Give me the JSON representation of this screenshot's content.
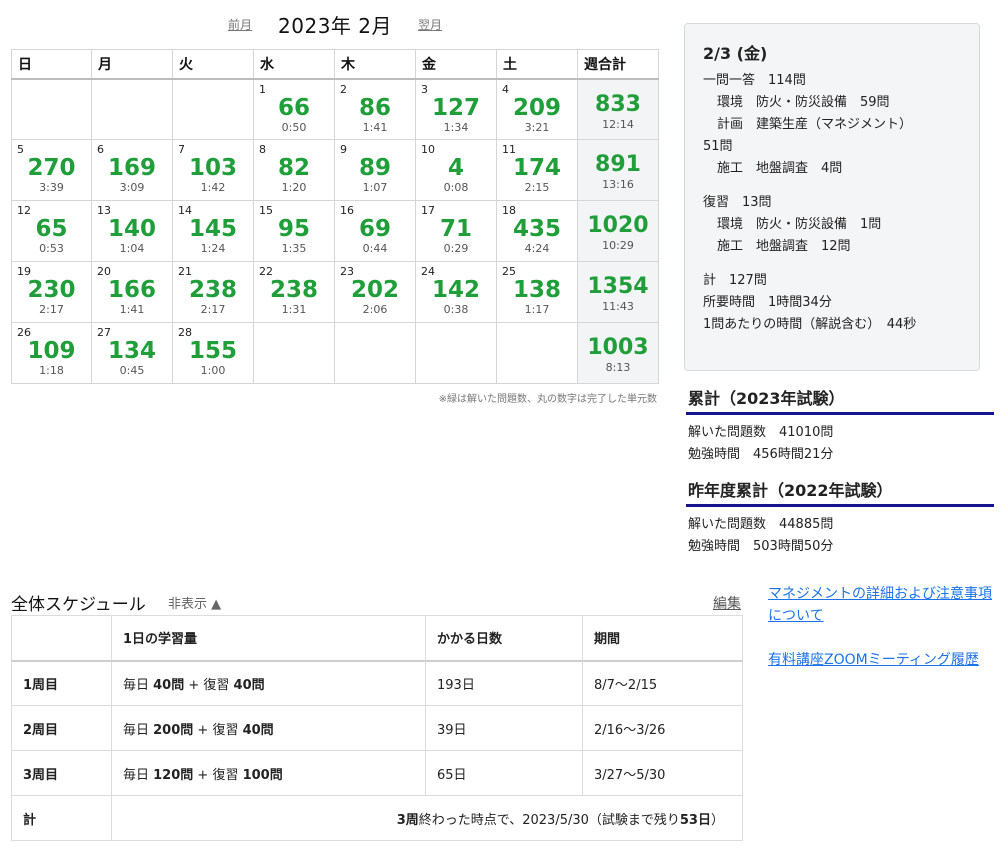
{
  "calendar": {
    "prev_label": "前月",
    "next_label": "翌月",
    "month_title": "2023年 2月",
    "headers": [
      "日",
      "月",
      "火",
      "水",
      "木",
      "金",
      "土",
      "週合計"
    ],
    "weeks": [
      {
        "days": [
          null,
          null,
          null,
          {
            "date": "1",
            "count": "66",
            "time": "0:50"
          },
          {
            "date": "2",
            "count": "86",
            "time": "1:41"
          },
          {
            "date": "3",
            "count": "127",
            "time": "1:34"
          },
          {
            "date": "4",
            "count": "209",
            "time": "3:21"
          }
        ],
        "total": {
          "count": "833",
          "time": "12:14"
        }
      },
      {
        "days": [
          {
            "date": "5",
            "count": "270",
            "time": "3:39"
          },
          {
            "date": "6",
            "count": "169",
            "time": "3:09"
          },
          {
            "date": "7",
            "count": "103",
            "time": "1:42"
          },
          {
            "date": "8",
            "count": "82",
            "time": "1:20"
          },
          {
            "date": "9",
            "count": "89",
            "time": "1:07"
          },
          {
            "date": "10",
            "count": "4",
            "time": "0:08"
          },
          {
            "date": "11",
            "count": "174",
            "time": "2:15"
          }
        ],
        "total": {
          "count": "891",
          "time": "13:16"
        }
      },
      {
        "days": [
          {
            "date": "12",
            "count": "65",
            "time": "0:53"
          },
          {
            "date": "13",
            "count": "140",
            "time": "1:04"
          },
          {
            "date": "14",
            "count": "145",
            "time": "1:24"
          },
          {
            "date": "15",
            "count": "95",
            "time": "1:35"
          },
          {
            "date": "16",
            "count": "69",
            "time": "0:44"
          },
          {
            "date": "17",
            "count": "71",
            "time": "0:29"
          },
          {
            "date": "18",
            "count": "435",
            "time": "4:24"
          }
        ],
        "total": {
          "count": "1020",
          "time": "10:29"
        }
      },
      {
        "days": [
          {
            "date": "19",
            "count": "230",
            "time": "2:17"
          },
          {
            "date": "20",
            "count": "166",
            "time": "1:41"
          },
          {
            "date": "21",
            "count": "238",
            "time": "2:17"
          },
          {
            "date": "22",
            "count": "238",
            "time": "1:31"
          },
          {
            "date": "23",
            "count": "202",
            "time": "2:06"
          },
          {
            "date": "24",
            "count": "142",
            "time": "0:38"
          },
          {
            "date": "25",
            "count": "138",
            "time": "1:17"
          }
        ],
        "total": {
          "count": "1354",
          "time": "11:43"
        }
      },
      {
        "days": [
          {
            "date": "26",
            "count": "109",
            "time": "1:18"
          },
          {
            "date": "27",
            "count": "134",
            "time": "0:45"
          },
          {
            "date": "28",
            "count": "155",
            "time": "1:00"
          },
          null,
          null,
          null,
          null
        ],
        "total": {
          "count": "1003",
          "time": "8:13"
        }
      }
    ],
    "note": "※緑は解いた問題数、丸の数字は完了した単元数"
  },
  "detail": {
    "date": "2/3 (金)",
    "lines": [
      {
        "text": "一問一答　114問",
        "indent": false
      },
      {
        "text": "環境　防火・防災設備　59問",
        "indent": true
      },
      {
        "text": "計画　建築生産（マネジメント）",
        "indent": true
      },
      {
        "text": "51問",
        "indent": false
      },
      {
        "text": "施工　地盤調査　4問",
        "indent": true
      },
      {
        "gap": true
      },
      {
        "text": "復習　13問",
        "indent": false
      },
      {
        "text": "環境　防火・防災設備　1問",
        "indent": true
      },
      {
        "text": "施工　地盤調査　12問",
        "indent": true
      },
      {
        "gap": true
      },
      {
        "text": "計　127問",
        "indent": false
      },
      {
        "text": "所要時間　1時間34分",
        "indent": false
      },
      {
        "text": "1問あたりの時間（解説含む）　44秒",
        "indent": false
      }
    ]
  },
  "cumulative": {
    "title": "累計（2023年試験）",
    "solved": "解いた問題数　41010問",
    "study_time": "勉強時間　456時間21分"
  },
  "last_year": {
    "title": "昨年度累計（2022年試験）",
    "solved": "解いた問題数　44885問",
    "study_time": "勉強時間　503時間50分"
  },
  "schedule": {
    "title": "全体スケジュール",
    "hide_label": "非表示 ▲",
    "edit_label": "編集",
    "headers": [
      "",
      "1日の学習量",
      "かかる日数",
      "期間"
    ],
    "rows": [
      {
        "label": "1周目",
        "daily_pre": "毎日 ",
        "daily_new": "40問",
        "daily_mid": " + 復習 ",
        "daily_review": "40問",
        "days": "193日",
        "period": "8/7〜2/15"
      },
      {
        "label": "2周目",
        "daily_pre": "毎日 ",
        "daily_new": "200問",
        "daily_mid": " + 復習 ",
        "daily_review": "40問",
        "days": "39日",
        "period": "2/16〜3/26"
      },
      {
        "label": "3周目",
        "daily_pre": "毎日 ",
        "daily_new": "120問",
        "daily_mid": " + 復習 ",
        "daily_review": "100問",
        "days": "65日",
        "period": "3/27〜5/30"
      }
    ],
    "total": {
      "label": "計",
      "s_laps": "3周",
      "s_mid": "終わった時点で、2023/5/30（試験まで残り",
      "s_remain": "53日",
      "s_end": "）"
    }
  },
  "links": [
    "マネジメントの詳細および注意事項について",
    "有料講座ZOOMミーティング履歴"
  ]
}
